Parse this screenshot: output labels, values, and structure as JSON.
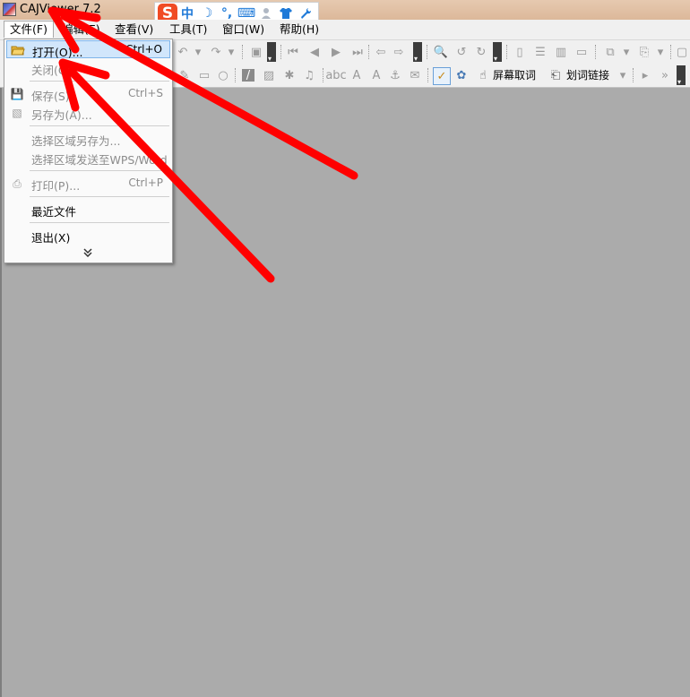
{
  "window": {
    "title": "CAJViewer 7.2"
  },
  "ime_toolbar": {
    "logo": "S",
    "items": [
      {
        "icon": "chinese-mode-icon",
        "text": "中"
      },
      {
        "icon": "moon-icon",
        "text": "☽"
      },
      {
        "icon": "punctuation-icon",
        "text": "°,"
      },
      {
        "icon": "keyboard-icon",
        "text": "⌨"
      },
      {
        "icon": "user-icon",
        "text": "●"
      },
      {
        "icon": "shirt-icon",
        "text": "▼"
      },
      {
        "icon": "wrench-icon",
        "text": "✎"
      }
    ]
  },
  "menubar": {
    "items": [
      {
        "label": "文件(F)"
      },
      {
        "label": "编辑(E)"
      },
      {
        "label": "查看(V)"
      },
      {
        "label": "工具(T)"
      },
      {
        "label": "窗口(W)"
      },
      {
        "label": "帮助(H)"
      }
    ]
  },
  "toolbar": {
    "screen_capture_label": "屏幕取词",
    "word_link_label": "划词链接"
  },
  "file_menu": {
    "items": [
      {
        "label": "打开(O)...",
        "shortcut": "Ctrl+O",
        "enabled": true,
        "highlighted": true
      },
      {
        "label": "关闭(C)",
        "shortcut": "",
        "enabled": false
      },
      {
        "label": "保存(S)",
        "shortcut": "Ctrl+S",
        "enabled": false
      },
      {
        "label": "另存为(A)...",
        "shortcut": "",
        "enabled": false
      },
      {
        "label": "选择区域另存为...",
        "shortcut": "",
        "enabled": false
      },
      {
        "label": "选择区域发送至WPS/Word",
        "shortcut": "",
        "enabled": false
      },
      {
        "label": "打印(P)...",
        "shortcut": "Ctrl+P",
        "enabled": false
      },
      {
        "label": "最近文件",
        "shortcut": "",
        "enabled": true
      },
      {
        "label": "退出(X)",
        "shortcut": "",
        "enabled": true
      }
    ],
    "expand_icon": "double-chevron-down-icon"
  },
  "annotations": {
    "arrow_color": "#ff0000"
  }
}
